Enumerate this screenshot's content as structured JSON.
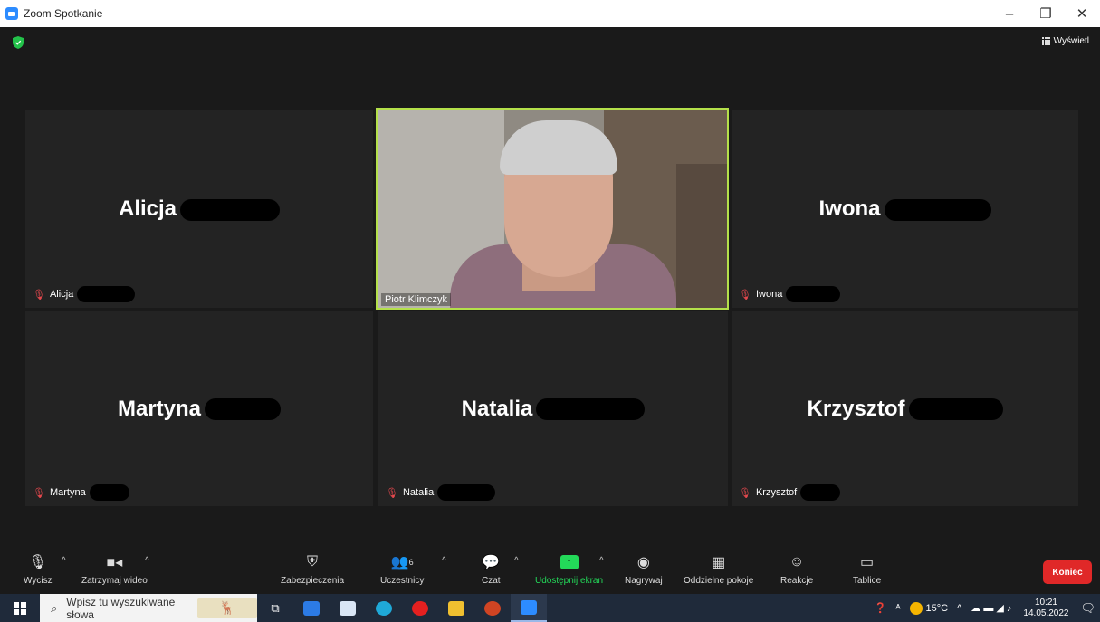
{
  "window": {
    "title": "Zoom Spotkanie",
    "minimize": "–",
    "restore": "❐",
    "close": "✕"
  },
  "meeting": {
    "view_label": "Wyświetl",
    "participants": [
      {
        "name": "Alicja",
        "label": "Alicja",
        "video": false
      },
      {
        "name": "Piotr Klimczyk",
        "label": "Piotr Klimczyk",
        "video": true,
        "active_speaker": true
      },
      {
        "name": "Iwona",
        "label": "Iwona",
        "video": false
      },
      {
        "name": "Martyna",
        "label": "Martyna",
        "video": false
      },
      {
        "name": "Natalia",
        "label": "Natalia",
        "video": false
      },
      {
        "name": "Krzysztof",
        "label": "Krzysztof",
        "video": false
      }
    ]
  },
  "toolbar": {
    "mute": "Wycisz",
    "stop_video": "Zatrzymaj wideo",
    "security": "Zabezpieczenia",
    "participants": "Uczestnicy",
    "participants_count": "6",
    "chat": "Czat",
    "share_screen": "Udostępnij ekran",
    "record": "Nagrywaj",
    "breakout_rooms": "Oddzielne pokoje",
    "reactions": "Reakcje",
    "whiteboards": "Tablice",
    "end": "Koniec"
  },
  "taskbar": {
    "search_placeholder": "Wpisz tu wyszukiwane słowa",
    "temperature": "15°C",
    "time": "10:21",
    "date": "14.05.2022"
  },
  "colors": {
    "active_speaker_border": "#b4e04a",
    "share_green": "#23d959",
    "end_red": "#e02828",
    "muted_red": "#e5484d"
  }
}
